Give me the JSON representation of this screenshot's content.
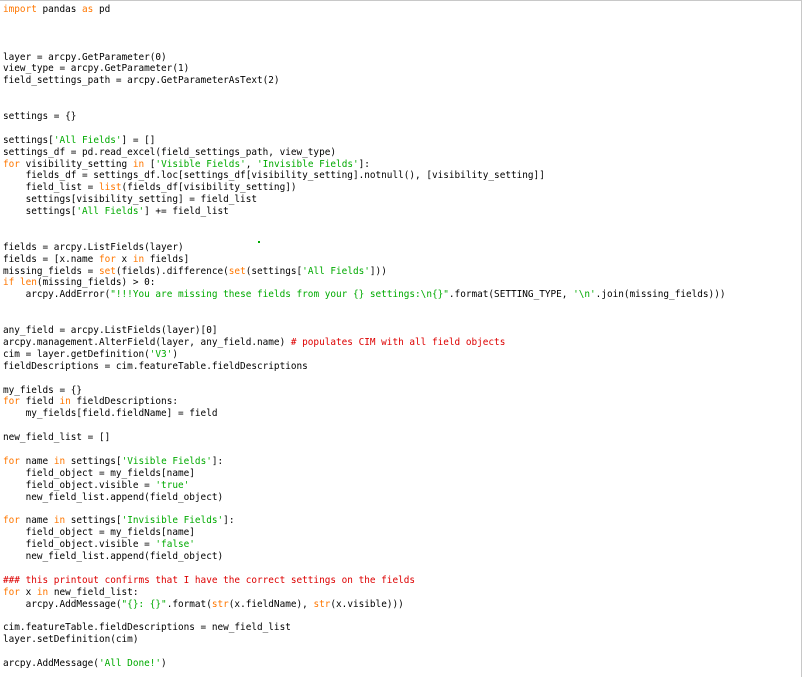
{
  "colors": {
    "background": "#ffffff",
    "text": "#000000",
    "keyword": "#ff7700",
    "string": "#00aa00",
    "comment": "#dd0000"
  },
  "code_lines": [
    [
      [
        "kw",
        "import"
      ],
      [
        "p",
        " pandas "
      ],
      [
        "kw",
        "as"
      ],
      [
        "p",
        " pd"
      ]
    ],
    [],
    [],
    [],
    [
      [
        "p",
        "layer = arcpy.GetParameter(0)"
      ]
    ],
    [
      [
        "p",
        "view_type = arcpy.GetParameter(1)"
      ]
    ],
    [
      [
        "p",
        "field_settings_path = arcpy.GetParameterAsText(2)"
      ]
    ],
    [],
    [],
    [
      [
        "p",
        "settings = {}"
      ]
    ],
    [],
    [
      [
        "p",
        "settings["
      ],
      [
        "s",
        "'All Fields'"
      ],
      [
        "p",
        "] = []"
      ]
    ],
    [
      [
        "p",
        "settings_df = pd.read_excel(field_settings_path, view_type)"
      ]
    ],
    [
      [
        "kw",
        "for"
      ],
      [
        "p",
        " visibility_setting "
      ],
      [
        "kw",
        "in"
      ],
      [
        "p",
        " ["
      ],
      [
        "s",
        "'Visible Fields'"
      ],
      [
        "p",
        ", "
      ],
      [
        "s",
        "'Invisible Fields'"
      ],
      [
        "p",
        "]:"
      ]
    ],
    [
      [
        "p",
        "    fields_df = settings_df.loc[settings_df[visibility_setting].notnull(), [visibility_setting]]"
      ]
    ],
    [
      [
        "p",
        "    field_list = "
      ],
      [
        "kw",
        "list"
      ],
      [
        "p",
        "(fields_df[visibility_setting])"
      ]
    ],
    [
      [
        "p",
        "    settings[visibility_setting] = field_list"
      ]
    ],
    [
      [
        "p",
        "    settings["
      ],
      [
        "s",
        "'All Fields'"
      ],
      [
        "p",
        "] += field_list"
      ]
    ],
    [],
    [],
    [
      [
        "p",
        "fields = arcpy.ListFields(layer)"
      ]
    ],
    [
      [
        "p",
        "fields = [x.name "
      ],
      [
        "kw",
        "for"
      ],
      [
        "p",
        " x "
      ],
      [
        "kw",
        "in"
      ],
      [
        "p",
        " fields]"
      ]
    ],
    [
      [
        "p",
        "missing_fields = "
      ],
      [
        "kw",
        "set"
      ],
      [
        "p",
        "(fields).difference("
      ],
      [
        "kw",
        "set"
      ],
      [
        "p",
        "(settings["
      ],
      [
        "s",
        "'All Fields'"
      ],
      [
        "p",
        "]))"
      ]
    ],
    [
      [
        "kw",
        "if"
      ],
      [
        "p",
        " "
      ],
      [
        "kw",
        "len"
      ],
      [
        "p",
        "(missing_fields) > 0:"
      ]
    ],
    [
      [
        "p",
        "    arcpy.AddError("
      ],
      [
        "s",
        "\"!!!You are missing these fields from your {} settings:\\n{}\""
      ],
      [
        "p",
        ".format(SETTING_TYPE, "
      ],
      [
        "s",
        "'\\n'"
      ],
      [
        "p",
        ".join(missing_fields)))"
      ]
    ],
    [],
    [],
    [
      [
        "p",
        "any_field = arcpy.ListFields(layer)[0]"
      ]
    ],
    [
      [
        "p",
        "arcpy.management.AlterField(layer, any_field.name) "
      ],
      [
        "c",
        "# populates CIM with all field objects"
      ]
    ],
    [
      [
        "p",
        "cim = layer.getDefinition("
      ],
      [
        "s",
        "'V3'"
      ],
      [
        "p",
        ")"
      ]
    ],
    [
      [
        "p",
        "fieldDescriptions = cim.featureTable.fieldDescriptions"
      ]
    ],
    [],
    [
      [
        "p",
        "my_fields = {}"
      ]
    ],
    [
      [
        "kw",
        "for"
      ],
      [
        "p",
        " field "
      ],
      [
        "kw",
        "in"
      ],
      [
        "p",
        " fieldDescriptions:"
      ]
    ],
    [
      [
        "p",
        "    my_fields[field.fieldName] = field"
      ]
    ],
    [],
    [
      [
        "p",
        "new_field_list = []"
      ]
    ],
    [],
    [
      [
        "kw",
        "for"
      ],
      [
        "p",
        " name "
      ],
      [
        "kw",
        "in"
      ],
      [
        "p",
        " settings["
      ],
      [
        "s",
        "'Visible Fields'"
      ],
      [
        "p",
        "]:"
      ]
    ],
    [
      [
        "p",
        "    field_object = my_fields[name]"
      ]
    ],
    [
      [
        "p",
        "    field_object.visible = "
      ],
      [
        "s",
        "'true'"
      ]
    ],
    [
      [
        "p",
        "    new_field_list.append(field_object)"
      ]
    ],
    [],
    [
      [
        "kw",
        "for"
      ],
      [
        "p",
        " name "
      ],
      [
        "kw",
        "in"
      ],
      [
        "p",
        " settings["
      ],
      [
        "s",
        "'Invisible Fields'"
      ],
      [
        "p",
        "]:"
      ]
    ],
    [
      [
        "p",
        "    field_object = my_fields[name]"
      ]
    ],
    [
      [
        "p",
        "    field_object.visible = "
      ],
      [
        "s",
        "'false'"
      ]
    ],
    [
      [
        "p",
        "    new_field_list.append(field_object)"
      ]
    ],
    [],
    [
      [
        "c",
        "### this printout confirms that I have the correct settings on the fields"
      ]
    ],
    [
      [
        "kw",
        "for"
      ],
      [
        "p",
        " x "
      ],
      [
        "kw",
        "in"
      ],
      [
        "p",
        " new_field_list:"
      ]
    ],
    [
      [
        "p",
        "    arcpy.AddMessage("
      ],
      [
        "s",
        "\"{}: {}\""
      ],
      [
        "p",
        ".format("
      ],
      [
        "kw",
        "str"
      ],
      [
        "p",
        "(x.fieldName), "
      ],
      [
        "kw",
        "str"
      ],
      [
        "p",
        "(x.visible)))"
      ]
    ],
    [],
    [
      [
        "p",
        "cim.featureTable.fieldDescriptions = new_field_list"
      ]
    ],
    [
      [
        "p",
        "layer.setDefinition(cim)"
      ]
    ],
    [],
    [
      [
        "p",
        "arcpy.AddMessage("
      ],
      [
        "s",
        "'All Done!'"
      ],
      [
        "p",
        ")"
      ]
    ]
  ]
}
